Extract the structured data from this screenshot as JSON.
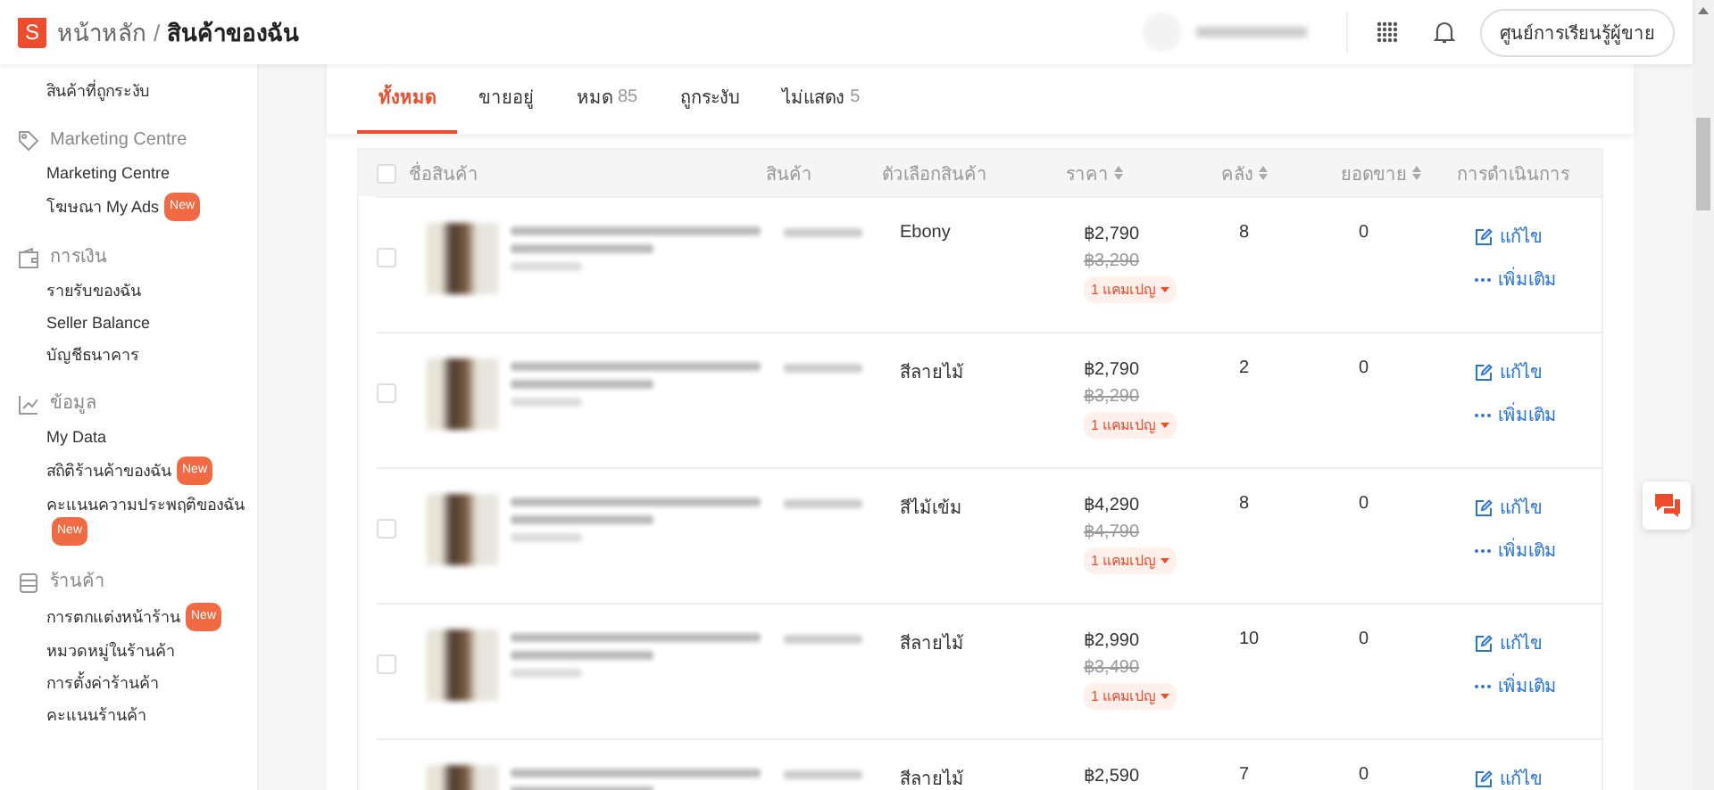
{
  "header": {
    "logo_letter": "S",
    "breadcrumb": [
      {
        "label": "หน้าหลัก",
        "current": false
      },
      {
        "label": "สินค้าของฉัน",
        "current": true
      }
    ],
    "separator": "/",
    "learning_button": "ศูนย์การเรียนรู้ผู้ขาย"
  },
  "sidebar": {
    "top_items": [
      {
        "label": "สินค้าที่ถูกระงับ"
      }
    ],
    "sections": [
      {
        "title": "Marketing Centre",
        "kind": "tag",
        "items": [
          {
            "label": "Marketing Centre"
          },
          {
            "label": "โฆษณา My Ads",
            "badge": "New"
          }
        ]
      },
      {
        "title": "การเงิน",
        "kind": "wallet",
        "items": [
          {
            "label": "รายรับของฉัน"
          },
          {
            "label": "Seller Balance"
          },
          {
            "label": "บัญชีธนาคาร"
          }
        ]
      },
      {
        "title": "ข้อมูล",
        "kind": "chart",
        "items": [
          {
            "label": "My Data"
          },
          {
            "label": "สถิติร้านค้าของฉัน",
            "badge": "New"
          },
          {
            "label": "คะแนนความประพฤติของฉัน",
            "badge": "New"
          }
        ]
      },
      {
        "title": "ร้านค้า",
        "kind": "store",
        "items": [
          {
            "label": "การตกแต่งหน้าร้าน",
            "badge": "New"
          },
          {
            "label": "หมวดหมู่ในร้านค้า"
          },
          {
            "label": "การตั้งค่าร้านค้า"
          },
          {
            "label": "คะแนนร้านค้า"
          }
        ]
      }
    ]
  },
  "tabs": [
    {
      "label": "ทั้งหมด",
      "selected": true
    },
    {
      "label": "ขายอยู่",
      "selected": false
    },
    {
      "label": "หมด",
      "count": "85",
      "selected": false
    },
    {
      "label": "ถูกระงับ",
      "selected": false
    },
    {
      "label": "ไม่แสดง",
      "count": "5",
      "selected": false
    }
  ],
  "table": {
    "header_checked": false,
    "columns": [
      {
        "label": "ชื่อสินค้า",
        "sortable": false
      },
      {
        "label": "สินค้า",
        "sortable": false
      },
      {
        "label": "ตัวเลือกสินค้า",
        "sortable": false
      },
      {
        "label": "ราคา",
        "sortable": true
      },
      {
        "label": "คลัง",
        "sortable": true
      },
      {
        "label": "ยอดขาย",
        "sortable": true
      },
      {
        "label": "การดำเนินการ",
        "sortable": false
      }
    ],
    "rows": [
      {
        "checked": false,
        "variant": "Ebony",
        "price": "฿2,790",
        "original_price": "฿3,290",
        "campaign": "1 แคมเปญ",
        "stock": "8",
        "sales": "0",
        "edit": "แก้ไข",
        "more": "เพิ่มเติม"
      },
      {
        "checked": false,
        "variant": "สีลายไม้",
        "price": "฿2,790",
        "original_price": "฿3,290",
        "campaign": "1 แคมเปญ",
        "stock": "2",
        "sales": "0",
        "edit": "แก้ไข",
        "more": "เพิ่มเติม"
      },
      {
        "checked": false,
        "variant": "สีไม้เข้ม",
        "price": "฿4,290",
        "original_price": "฿4,790",
        "campaign": "1 แคมเปญ",
        "stock": "8",
        "sales": "0",
        "edit": "แก้ไข",
        "more": "เพิ่มเติม"
      },
      {
        "checked": false,
        "variant": "สีลายไม้",
        "price": "฿2,990",
        "original_price": "฿3,490",
        "campaign": "1 แคมเปญ",
        "stock": "10",
        "sales": "0",
        "edit": "แก้ไข",
        "more": "เพิ่มเติม"
      },
      {
        "variant": "สีลายไม้",
        "price": "฿2,590",
        "stock": "7",
        "sales": "0",
        "edit": "แก้ไข"
      }
    ]
  }
}
